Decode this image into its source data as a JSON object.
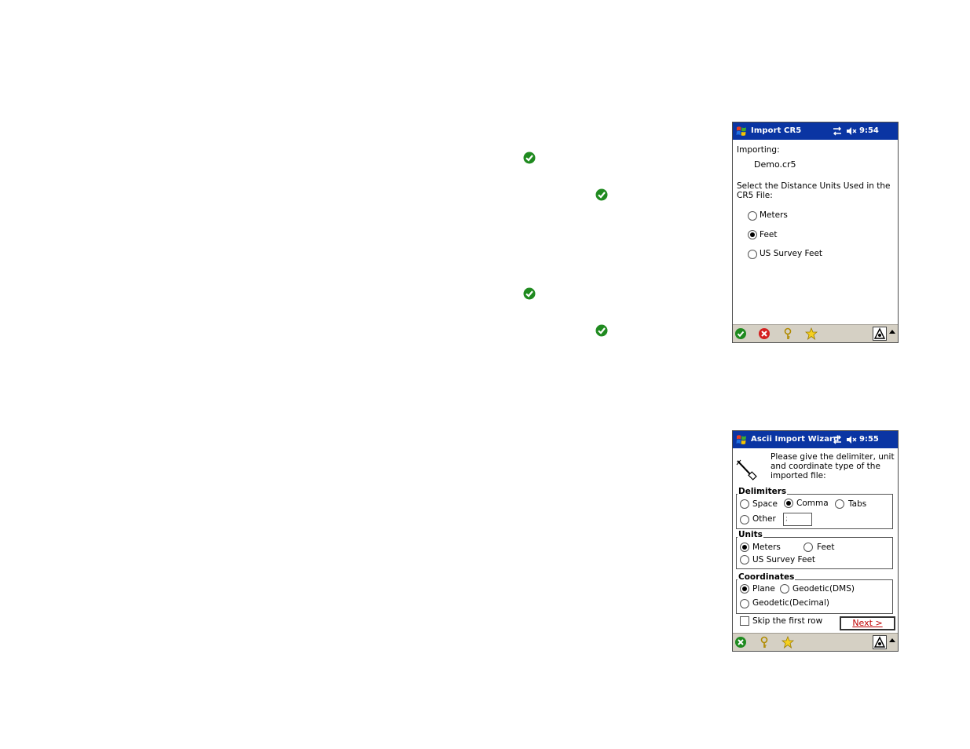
{
  "screen1": {
    "title": "Import CR5",
    "time": "9:54",
    "importing_label": "Importing:",
    "file_name": "Demo.cr5",
    "prompt_line1": "Select the Distance Units Used in the",
    "prompt_line2": "CR5 File:",
    "options": [
      {
        "label": "Meters",
        "selected": false
      },
      {
        "label": "Feet",
        "selected": true
      },
      {
        "label": "US Survey Feet",
        "selected": false
      }
    ]
  },
  "screen2": {
    "title": "Ascii Import Wizard",
    "time": "9:55",
    "prompt_line1": "Please give the delimiter, unit",
    "prompt_line2": "and coordinate type of the",
    "prompt_line3": "imported file:",
    "delimiters": {
      "title": "Delimiters",
      "space": "Space",
      "comma": "Comma",
      "tabs": "Tabs",
      "other": "Other",
      "other_value": ";",
      "selected": "Comma"
    },
    "units": {
      "title": "Units",
      "meters": "Meters",
      "feet": "Feet",
      "us_survey_feet": "US Survey Feet",
      "selected": "Meters"
    },
    "coordinates": {
      "title": "Coordinates",
      "plane": "Plane",
      "geodetic_dms": "Geodetic(DMS)",
      "geodetic_decimal": "Geodetic(Decimal)",
      "selected": "Plane"
    },
    "skip_first_row": "Skip the first row",
    "skip_checked": false,
    "next_label": "Next >"
  },
  "colors": {
    "titlebar": "#0a35a3",
    "toolbar": "#d5d0c4",
    "check_green": "#1f8a1f",
    "cancel_red": "#d42020",
    "next_text": "#c00000"
  },
  "icons": [
    "windows-start-icon",
    "sync-icon",
    "speaker-muted-icon",
    "ok-check-icon",
    "cancel-x-icon",
    "help-key-icon",
    "favorites-star-icon",
    "sip-keyboard-icon",
    "wizard-wand-icon"
  ]
}
